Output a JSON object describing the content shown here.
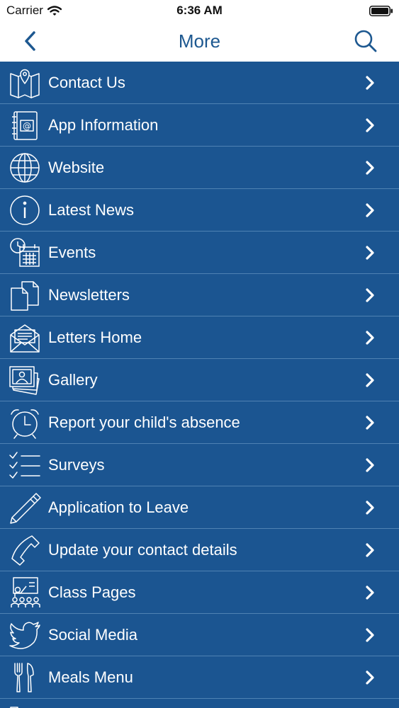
{
  "status_bar": {
    "carrier": "Carrier",
    "time": "6:36 AM"
  },
  "nav": {
    "title": "More",
    "back_icon": "chevron-left-icon",
    "search_icon": "search-icon"
  },
  "colors": {
    "list_background": "#1b5591",
    "divider": "#4f82b3",
    "accent": "#1d5890",
    "text": "#ffffff"
  },
  "menu": {
    "items": [
      {
        "label": "Contact Us",
        "icon": "map-pin-icon"
      },
      {
        "label": "App Information",
        "icon": "address-book-icon"
      },
      {
        "label": "Website",
        "icon": "globe-icon"
      },
      {
        "label": "Latest News",
        "icon": "info-icon"
      },
      {
        "label": "Events",
        "icon": "calendar-clock-icon"
      },
      {
        "label": "Newsletters",
        "icon": "documents-icon"
      },
      {
        "label": "Letters Home",
        "icon": "envelope-icon"
      },
      {
        "label": "Gallery",
        "icon": "photos-icon"
      },
      {
        "label": "Report your child's absence",
        "icon": "alarm-clock-icon"
      },
      {
        "label": "Surveys",
        "icon": "checklist-icon"
      },
      {
        "label": "Application to Leave",
        "icon": "pencil-icon"
      },
      {
        "label": "Update your contact details",
        "icon": "phone-icon"
      },
      {
        "label": "Class Pages",
        "icon": "classroom-icon"
      },
      {
        "label": "Social Media",
        "icon": "twitter-bird-icon"
      },
      {
        "label": "Meals Menu",
        "icon": "fork-knife-icon"
      },
      {
        "label": "",
        "icon": "checkbox-list-icon"
      }
    ]
  }
}
